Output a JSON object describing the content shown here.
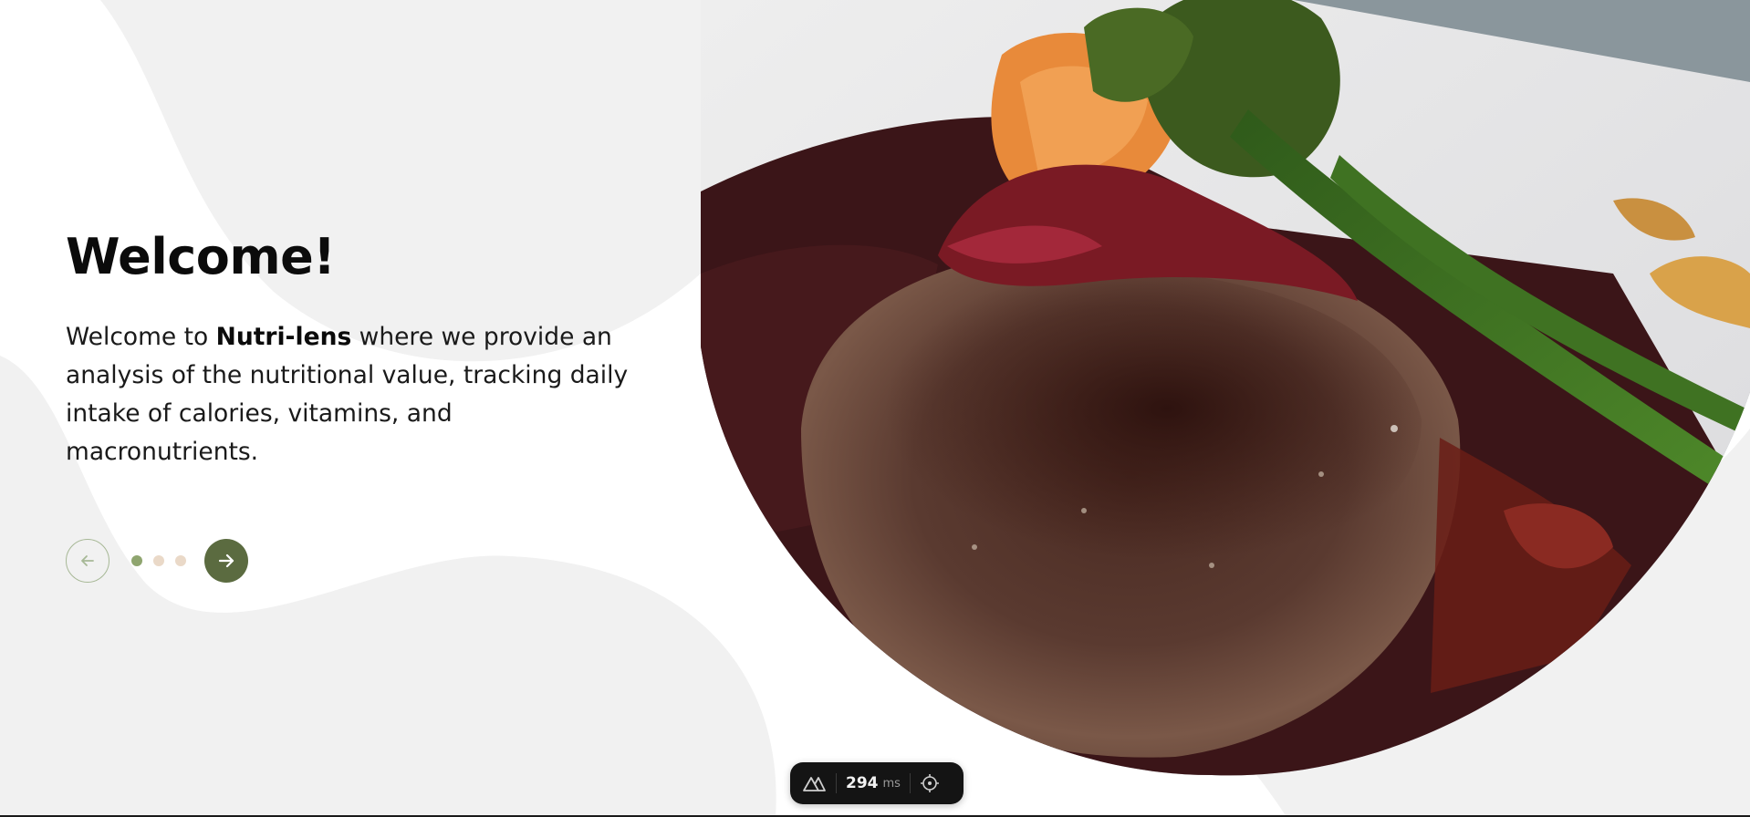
{
  "intro": {
    "heading": "Welcome!",
    "text_before": "Welcome to ",
    "brand": "Nutri-lens",
    "text_after": " where we provide an analysis of the nutritional value, tracking daily intake of calories, vitamins, and macronutrients."
  },
  "carousel": {
    "prev_icon": "arrow-left-icon",
    "next_icon": "arrow-right-icon",
    "dots": [
      {
        "active": true,
        "color": "#8fa56f"
      },
      {
        "active": false,
        "color": "#ead9c8"
      },
      {
        "active": false,
        "color": "#ead9c8"
      }
    ]
  },
  "hero": {
    "subject": "seared steak with berry sauce and broccolini"
  },
  "devtools": {
    "logo_icon": "nuxt-logo-icon",
    "timing_value": "294",
    "timing_unit": "ms",
    "inspect_icon": "crosshair-icon"
  },
  "colors": {
    "accent": "#5b6b40",
    "blob_grey": "#f1f1f1"
  }
}
